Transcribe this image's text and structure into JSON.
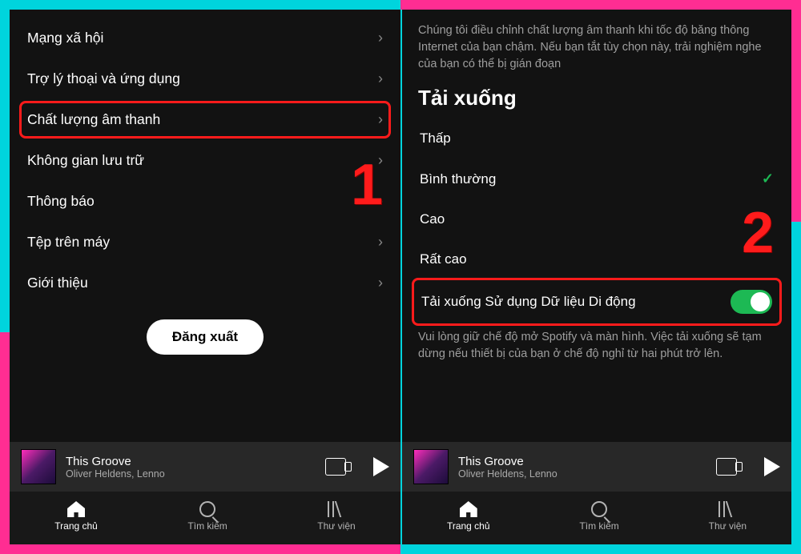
{
  "left": {
    "items": [
      {
        "label": "Mạng xã hội"
      },
      {
        "label": "Trợ lý thoại và ứng dụng"
      },
      {
        "label": "Chất lượng âm thanh"
      },
      {
        "label": "Không gian lưu trữ"
      },
      {
        "label": "Thông báo"
      },
      {
        "label": "Tệp trên máy"
      },
      {
        "label": "Giới thiệu"
      }
    ],
    "logout": "Đăng xuất",
    "step": "1"
  },
  "right": {
    "desc": "Chúng tôi điều chỉnh chất lượng âm thanh khi tốc độ băng thông Internet của bạn chậm. Nếu bạn tắt tùy chọn này, trải nghiệm nghe của bạn có thể bị gián đoạn",
    "header": "Tải xuống",
    "options": [
      "Thấp",
      "Bình thường",
      "Cao",
      "Rất cao"
    ],
    "selected_index": 1,
    "toggle_label": "Tải xuống Sử dụng Dữ liệu Di động",
    "note": "Vui lòng giữ chế độ mở Spotify và màn hình. Việc tải xuống sẽ tạm dừng nếu thiết bị của bạn ở chế độ nghỉ từ hai phút trở lên.",
    "step": "2"
  },
  "now_playing": {
    "title": "This Groove",
    "artist": "Oliver Heldens, Lenno"
  },
  "tabs": {
    "home": "Trang chủ",
    "search": "Tìm kiếm",
    "library": "Thư viện"
  }
}
